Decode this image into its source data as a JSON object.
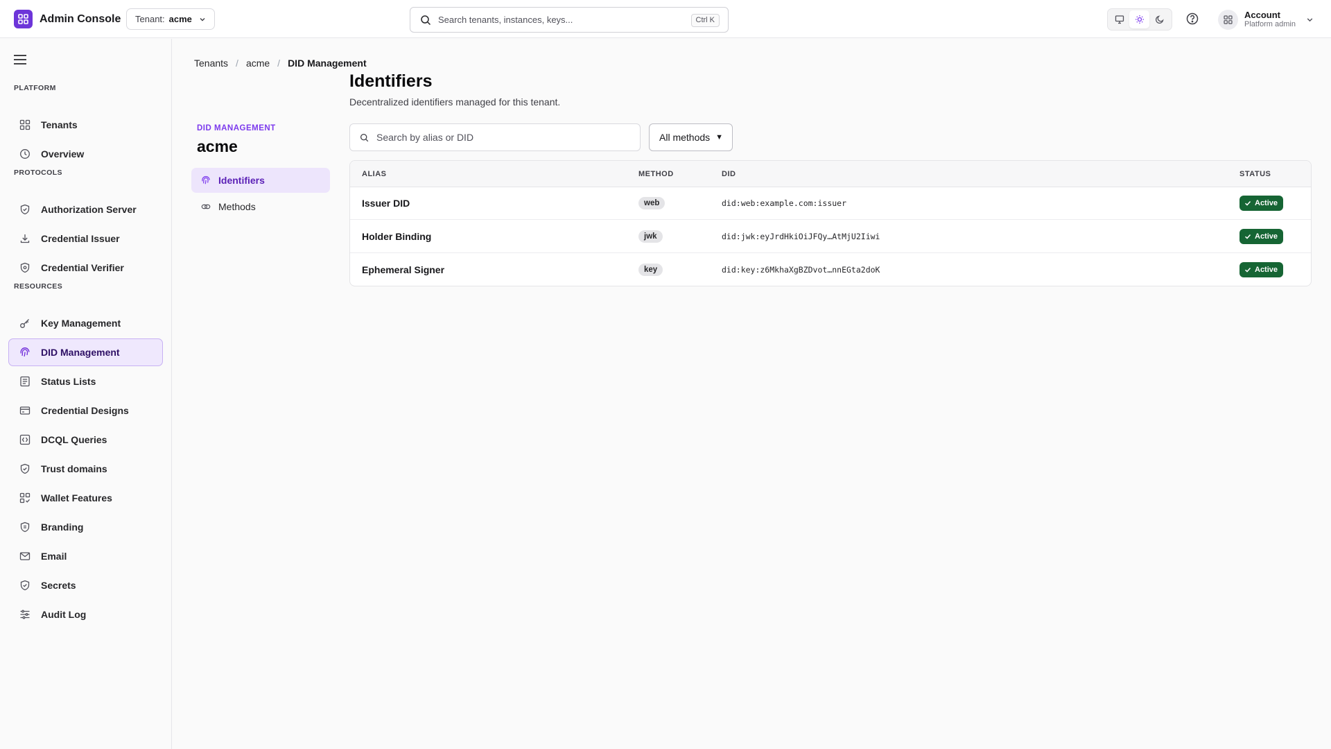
{
  "app": {
    "name": "Admin Console",
    "brand_color": "#6d35d9"
  },
  "topbar": {
    "tenant_label": "Tenant:",
    "tenant_value": "acme",
    "search_placeholder": "Search tenants, instances, keys...",
    "search_shortcut": "Ctrl K",
    "theme_modes": [
      "monitor-icon",
      "sun-icon",
      "moon-icon"
    ],
    "theme_active": "light",
    "account_name": "Account",
    "account_role": "Platform admin"
  },
  "sidebar": {
    "sections": [
      {
        "title": "PLATFORM",
        "items": [
          {
            "label": "Tenants",
            "icon": "grid-icon"
          },
          {
            "label": "Overview",
            "icon": "clock-icon"
          }
        ]
      },
      {
        "title": "PROTOCOLS",
        "items": [
          {
            "label": "Authorization Server",
            "icon": "shield-check-icon"
          },
          {
            "label": "Credential Issuer",
            "icon": "download-icon"
          },
          {
            "label": "Credential Verifier",
            "icon": "shield-check-icon"
          }
        ]
      },
      {
        "title": "RESOURCES",
        "items": [
          {
            "label": "Key Management",
            "icon": "key-icon"
          },
          {
            "label": "DID Management",
            "icon": "fingerprint-icon",
            "active": true
          },
          {
            "label": "Status Lists",
            "icon": "list-icon"
          },
          {
            "label": "Credential Designs",
            "icon": "card-icon"
          },
          {
            "label": "DCQL Queries",
            "icon": "query-icon"
          },
          {
            "label": "Trust domains",
            "icon": "shield-check-icon"
          },
          {
            "label": "Wallet Features",
            "icon": "grid-check-icon"
          },
          {
            "label": "Branding",
            "icon": "shield-icon"
          },
          {
            "label": "Email",
            "icon": "mail-icon"
          },
          {
            "label": "Secrets",
            "icon": "shield-check-icon"
          },
          {
            "label": "Audit Log",
            "icon": "sliders-icon"
          }
        ]
      }
    ]
  },
  "breadcrumb": {
    "items": [
      "Tenants",
      "acme"
    ],
    "current": "DID Management"
  },
  "sub_nav": {
    "kicker": "DID MANAGEMENT",
    "title": "acme",
    "items": [
      {
        "label": "Identifiers",
        "icon": "fingerprint-icon",
        "active": true
      },
      {
        "label": "Methods",
        "icon": "link-icon"
      }
    ]
  },
  "page": {
    "title": "Identifiers",
    "description": "Decentralized identifiers managed for this tenant.",
    "search_placeholder": "Search by alias or DID",
    "method_filter": "All methods"
  },
  "table": {
    "columns": [
      "ALIAS",
      "METHOD",
      "DID",
      "STATUS"
    ],
    "rows": [
      {
        "alias": "Issuer DID",
        "method": "web",
        "did": "did:web:example.com:issuer",
        "status": "Active"
      },
      {
        "alias": "Holder Binding",
        "method": "jwk",
        "did": "did:jwk:eyJrdHkiOiJFQy…AtMjU2Iiwi",
        "status": "Active"
      },
      {
        "alias": "Ephemeral Signer",
        "method": "key",
        "did": "did:key:z6MkhaXgBZDvot…nnEGta2doK",
        "status": "Active"
      }
    ],
    "status_color": "#166534"
  }
}
